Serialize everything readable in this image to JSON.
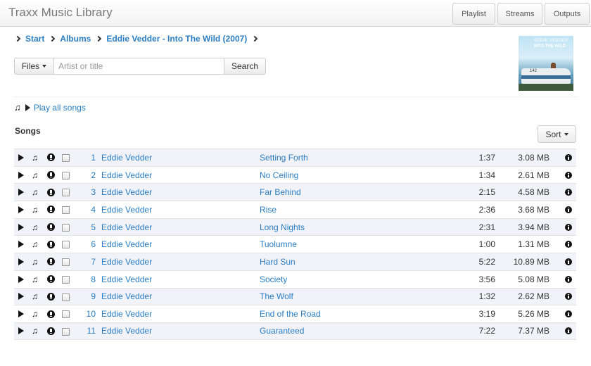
{
  "app": {
    "title": "Traxx Music Library"
  },
  "nav": {
    "playlist": "Playlist",
    "streams": "Streams",
    "outputs": "Outputs"
  },
  "breadcrumb": [
    "Start",
    "Albums",
    "Eddie Vedder - Into The Wild (2007)"
  ],
  "search": {
    "files_label": "Files",
    "placeholder": "Artist or title",
    "button_label": "Search"
  },
  "album_art": {
    "line1": "EDDIE VEDDER",
    "line2": "INTO THE WILD",
    "bus_number": "142"
  },
  "play_all": {
    "label": "Play all songs"
  },
  "songs_section": {
    "heading": "Songs",
    "sort_label": "Sort"
  },
  "songs": [
    {
      "num": "1",
      "artist": "Eddie Vedder",
      "title": "Setting Forth",
      "duration": "1:37",
      "size": "3.08 MB"
    },
    {
      "num": "2",
      "artist": "Eddie Vedder",
      "title": "No Ceiling",
      "duration": "1:34",
      "size": "2.61 MB"
    },
    {
      "num": "3",
      "artist": "Eddie Vedder",
      "title": "Far Behind",
      "duration": "2:15",
      "size": "4.58 MB"
    },
    {
      "num": "4",
      "artist": "Eddie Vedder",
      "title": "Rise",
      "duration": "2:36",
      "size": "3.68 MB"
    },
    {
      "num": "5",
      "artist": "Eddie Vedder",
      "title": "Long Nights",
      "duration": "2:31",
      "size": "3.94 MB"
    },
    {
      "num": "6",
      "artist": "Eddie Vedder",
      "title": "Tuolumne",
      "duration": "1:00",
      "size": "1.31 MB"
    },
    {
      "num": "7",
      "artist": "Eddie Vedder",
      "title": "Hard Sun",
      "duration": "5:22",
      "size": "10.89 MB"
    },
    {
      "num": "8",
      "artist": "Eddie Vedder",
      "title": "Society",
      "duration": "3:56",
      "size": "5.08 MB"
    },
    {
      "num": "9",
      "artist": "Eddie Vedder",
      "title": "The Wolf",
      "duration": "1:32",
      "size": "2.62 MB"
    },
    {
      "num": "10",
      "artist": "Eddie Vedder",
      "title": "End of the Road",
      "duration": "3:19",
      "size": "5.26 MB"
    },
    {
      "num": "11",
      "artist": "Eddie Vedder",
      "title": "Guaranteed",
      "duration": "7:22",
      "size": "7.37 MB"
    }
  ],
  "colors": {
    "link": "#2a7dc3",
    "row_stripe": "#f2f2f9"
  },
  "icons": {
    "row_play": "play-icon",
    "row_note": "music-note-icon",
    "row_download": "download-icon",
    "row_info": "info-icon"
  }
}
